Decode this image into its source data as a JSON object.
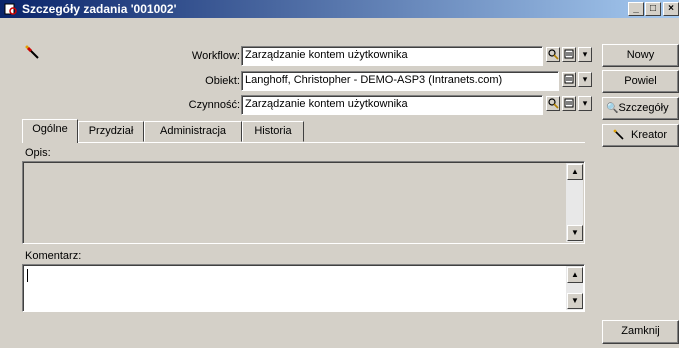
{
  "window": {
    "title": "Szczegóły zadania '001002'",
    "min_label": "_",
    "max_label": "□",
    "close_label": "×"
  },
  "form": {
    "workflow_label": "Workflow:",
    "workflow_value": "Zarządzanie kontem użytkownika",
    "obiekt_label": "Obiekt:",
    "obiekt_value": "Langhoff, Christopher - DEMO-ASP3 (Intranets.com)",
    "czynnosc_label": "Czynność:",
    "czynnosc_value": "Zarządzanie kontem użytkownika"
  },
  "tabs": [
    {
      "label": "Ogólne"
    },
    {
      "label": "Przydział"
    },
    {
      "label": "Administracja"
    },
    {
      "label": "Historia"
    }
  ],
  "panel": {
    "opis_label": "Opis:",
    "komentarz_label": "Komentarz:"
  },
  "buttons": {
    "nowy": "Nowy",
    "powiel": "Powiel",
    "szczegoly": "Szczegóły",
    "kreator": "Kreator",
    "zamknij": "Zamknij"
  },
  "colors": {
    "titlebar_start": "#0a246a",
    "titlebar_end": "#a6caf0",
    "face": "#d4d0c8"
  }
}
